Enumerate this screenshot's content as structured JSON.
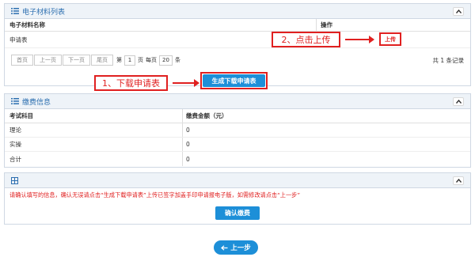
{
  "materials_panel": {
    "title": "电子材料列表",
    "col_name": "电子材料名称",
    "col_action": "操作",
    "rows": [
      {
        "name": "申请表",
        "action": "上传"
      }
    ],
    "pager": {
      "first": "首页",
      "prev": "上一页",
      "next": "下一页",
      "last": "尾页",
      "page_prefix": "第",
      "page_value": "1",
      "page_suffix": "页",
      "per_page_prefix": "每页",
      "per_page_value": "20",
      "per_page_suffix": "条",
      "total": "共 1 条记录"
    },
    "generate_button": "生成下载申请表"
  },
  "annotations": {
    "step1": "1、下载申请表",
    "step2": "2、点击上传"
  },
  "fee_panel": {
    "title": "缴费信息",
    "col_subject": "考试科目",
    "col_amount": "缴费金额（元）",
    "rows": [
      {
        "subject": "理论",
        "amount": "0"
      },
      {
        "subject": "实操",
        "amount": "0"
      },
      {
        "subject": "合计",
        "amount": "0"
      }
    ]
  },
  "notice_panel": {
    "text": "请确认填写的信息，确认无误请点击“生成下载申请表”上传已签字加盖手印申请报电子版，如需修改请点击“上一步”",
    "confirm_button": "确认缴费"
  },
  "back_button": "上一步",
  "colors": {
    "accent": "#1d8fd8",
    "annotation_red": "#e02020",
    "notice_red": "#e02020",
    "header_bg": "#eef3f8"
  }
}
